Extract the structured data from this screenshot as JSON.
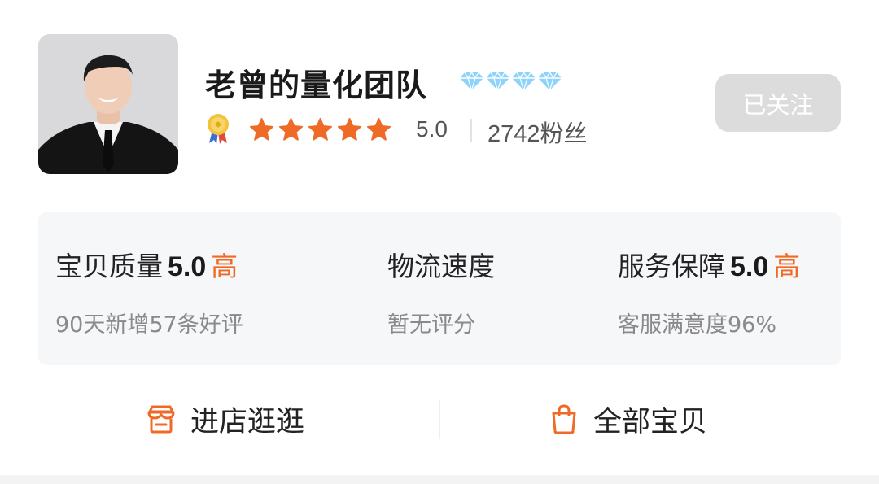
{
  "shop": {
    "name": "老曾的量化团队",
    "diamond_count": 4,
    "rating": 5,
    "score_text": "5.0",
    "fans_count": "2742",
    "fans_label": "粉丝",
    "follow_label": "已关注"
  },
  "metrics": [
    {
      "title": "宝贝质量",
      "value": "5.0",
      "level": "高",
      "sub": "90天新增57条好评"
    },
    {
      "title": "物流速度",
      "value": "",
      "level": "",
      "sub": "暂无评分"
    },
    {
      "title": "服务保障",
      "value": "5.0",
      "level": "高",
      "sub": "客服满意度96%"
    }
  ],
  "actions": {
    "enter_store": "进店逛逛",
    "all_items": "全部宝贝"
  },
  "colors": {
    "accent": "#f06a27",
    "diamond": "#8fd3fb",
    "follow_bg": "#dcdcdc",
    "card_bg": "#f6f7f9"
  },
  "icons": [
    "diamond-icon",
    "medal-icon",
    "star-icon",
    "store-icon",
    "bag-icon"
  ]
}
